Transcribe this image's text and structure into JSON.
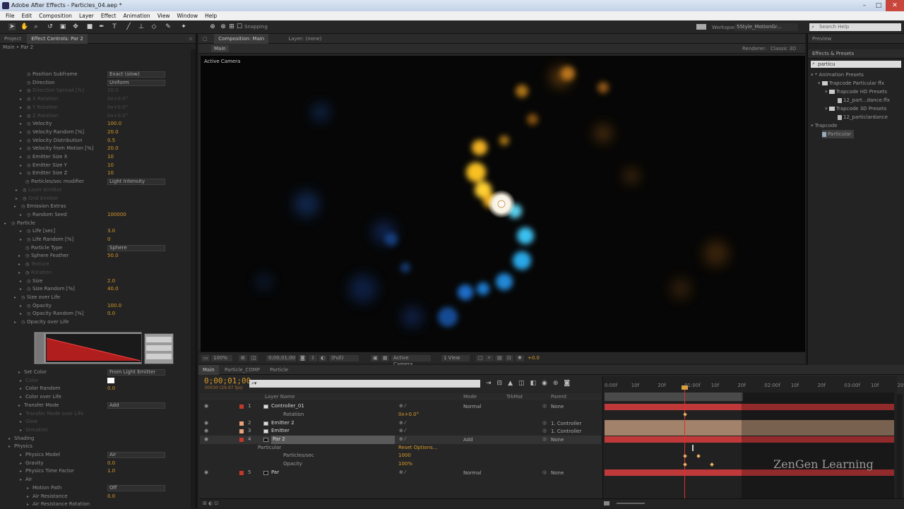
{
  "window": {
    "title": "Adobe After Effects - Particles_04.aep *"
  },
  "menu": [
    "File",
    "Edit",
    "Composition",
    "Layer",
    "Effect",
    "Animation",
    "View",
    "Window",
    "Help"
  ],
  "toolbar": {
    "snapping": "Snapping",
    "workspace_label": "Workspace:",
    "workspace_value": "5Style_MotionGr...",
    "search_placeholder": "Search Help"
  },
  "effect_controls": {
    "tabs": [
      "Project",
      "Effect Controls: Par 2"
    ],
    "subtitle": "Main • Par 2",
    "rows": [
      {
        "name": "Position Subframe",
        "value": "Exact (slow)",
        "type": "dropdown"
      },
      {
        "name": "Direction",
        "value": "Uniform",
        "type": "dropdown"
      },
      {
        "name": "Direction Spread [%]",
        "value": "20.0",
        "dim": true
      },
      {
        "name": "X Rotation",
        "value": "0x+0.0°",
        "dim": true
      },
      {
        "name": "Y Rotation",
        "value": "0x+0.0°",
        "dim": true
      },
      {
        "name": "Z Rotation",
        "value": "0x+0.0°",
        "dim": true
      },
      {
        "name": "Velocity",
        "value": "100.0"
      },
      {
        "name": "Velocity Random [%]",
        "value": "20.0"
      },
      {
        "name": "Velocity Distribution",
        "value": "0.5"
      },
      {
        "name": "Velocity from Motion [%]",
        "value": "20.0"
      },
      {
        "name": "Emitter Size X",
        "value": "10"
      },
      {
        "name": "Emitter Size Y",
        "value": "10"
      },
      {
        "name": "Emitter Size Z",
        "value": "10"
      },
      {
        "name": "Particles/sec modifier",
        "value": "Light Intensity",
        "type": "dropdown"
      },
      {
        "name": "Layer Emitter",
        "value": "",
        "dim": true
      },
      {
        "name": "Grid Emitter",
        "value": "",
        "dim": true
      },
      {
        "name": "Emission Extras",
        "value": ""
      },
      {
        "name": "Random Seed",
        "value": "100000"
      },
      {
        "name": "Particle",
        "value": ""
      },
      {
        "name": "Life [sec]",
        "value": "3.0"
      },
      {
        "name": "Life Random [%]",
        "value": "0"
      },
      {
        "name": "Particle Type",
        "value": "Sphere",
        "type": "dropdown"
      },
      {
        "name": "Sphere Feather",
        "value": "50.0"
      },
      {
        "name": "Texture",
        "value": "",
        "dim": true
      },
      {
        "name": "Rotation",
        "value": "",
        "dim": true
      },
      {
        "name": "Size",
        "value": "2.0"
      },
      {
        "name": "Size Random [%]",
        "value": "40.0"
      },
      {
        "name": "Size over Life",
        "value": ""
      },
      {
        "name": "Opacity",
        "value": "100.0"
      },
      {
        "name": "Opacity Random [%]",
        "value": "0.0"
      },
      {
        "name": "Opacity over Life",
        "value": ""
      }
    ],
    "rows2": [
      {
        "name": "Set Color",
        "value": "From Light Emitter",
        "type": "dropdown"
      },
      {
        "name": "Color",
        "value": "",
        "dim": true
      },
      {
        "name": "Color Random",
        "value": "0.0"
      },
      {
        "name": "Color over Life",
        "value": ""
      },
      {
        "name": "Transfer Mode",
        "value": "Add",
        "type": "dropdown"
      },
      {
        "name": "Transfer Mode over Life",
        "value": "",
        "dim": true
      },
      {
        "name": "Glow",
        "value": "",
        "dim": true
      },
      {
        "name": "Streaklet",
        "value": "",
        "dim": true
      },
      {
        "name": "Shading",
        "value": ""
      },
      {
        "name": "Physics",
        "value": ""
      },
      {
        "name": "Physics Model",
        "value": "Air",
        "type": "dropdown"
      },
      {
        "name": "Gravity",
        "value": "0.0"
      },
      {
        "name": "Physics Time Factor",
        "value": "1.0"
      },
      {
        "name": "Air",
        "value": ""
      },
      {
        "name": "Motion Path",
        "value": "Off",
        "type": "dropdown"
      },
      {
        "name": "Air Resistance",
        "value": "0.0"
      },
      {
        "name": "Air Resistance Rotation",
        "value": ""
      }
    ]
  },
  "composition": {
    "tabs": [
      "Composition: Main",
      "Layer: (none)"
    ],
    "sub_tab": "Main",
    "renderer": "Renderer:",
    "renderer_value": "Classic 3D",
    "camera_label": "Active Camera",
    "zoom": "100%",
    "time": "0;00;01;00",
    "resolution": "(Full)",
    "view_camera": "Active Camera",
    "views": "1 View",
    "exposure": "+0.0"
  },
  "effects_presets": {
    "tabs": [
      "Preview",
      "Effects & Presets"
    ],
    "search": "particu",
    "items": [
      "* Animation Presets",
      "Trapcode Particular ffx",
      "Trapcode HD Presets",
      "12_part...dance.ffx",
      "Trapcode 3D Presets",
      "12_particlardance",
      "Trapcode",
      "Particular"
    ]
  },
  "timeline": {
    "tabs": [
      "Main",
      "Particle_COMP",
      "Particle"
    ],
    "timecode": "0;00;01;00",
    "fps": "00030 (29.97 fps)",
    "columns": [
      "Layer Name",
      "Mode",
      "TrkMat",
      "Parent"
    ],
    "layers": [
      {
        "idx": "1",
        "name": "Controller_01",
        "mode": "Normal",
        "parent": "None",
        "color": "#c0392b"
      },
      {
        "idx": "",
        "name": "Rotation",
        "value": "0x+0.0°",
        "sub": true
      },
      {
        "idx": "2",
        "name": "Emitter 2",
        "mode": "",
        "parent": "1. Controller",
        "color": "#e8a27a"
      },
      {
        "idx": "3",
        "name": "Emitter",
        "mode": "",
        "parent": "1. Controller",
        "color": "#e8a27a"
      },
      {
        "idx": "4",
        "name": "Par 2",
        "mode": "Add",
        "parent": "None",
        "color": "#c0392b"
      },
      {
        "idx": "",
        "name": "Particular",
        "value": "Reset  Options...",
        "sub": true
      },
      {
        "idx": "",
        "name": "Particles/sec",
        "value": "1000",
        "sub": true
      },
      {
        "idx": "",
        "name": "Opacity",
        "value": "100%",
        "sub": true
      },
      {
        "idx": "5",
        "name": "Par",
        "mode": "Normal",
        "parent": "None",
        "color": "#c0392b"
      }
    ],
    "ruler": [
      "0:00f",
      "10f",
      "20f",
      "01:00f",
      "10f",
      "20f",
      "02:00f",
      "10f",
      "20f",
      "03:00f",
      "10f",
      "20f"
    ]
  },
  "watermark": "ZenGen Learning"
}
